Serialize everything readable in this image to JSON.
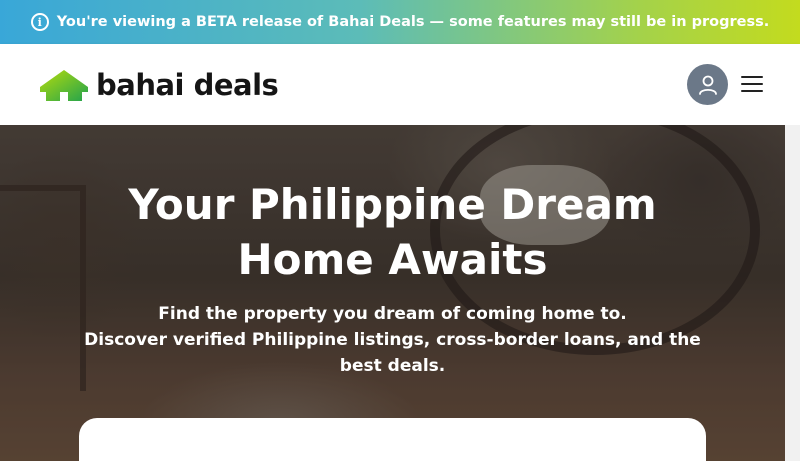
{
  "banner": {
    "text": "You're viewing a BETA release of Bahai Deals — some features may still be in progress.",
    "icon": "info-icon",
    "gradient": [
      "#39a7d8",
      "#a4d24a",
      "#c3db1e"
    ]
  },
  "header": {
    "logo_text": "bahai deals",
    "logo_icon": "house-icon",
    "logo_colors": [
      "#9bd20f",
      "#2ea84a"
    ],
    "avatar_icon": "user-icon",
    "menu_icon": "hamburger-icon"
  },
  "hero": {
    "title_line1": "Your Philippine Dream",
    "title_line2": "Home Awaits",
    "subtitle_line1": "Find the property you dream of coming home to.",
    "subtitle_line2": "Discover verified Philippine listings, cross-border loans, and the best deals."
  }
}
